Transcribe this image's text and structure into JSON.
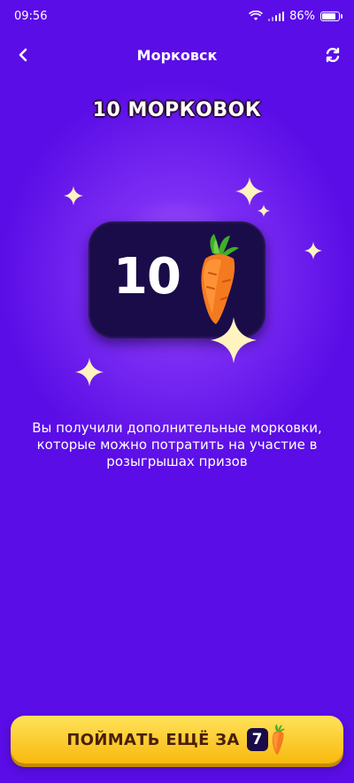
{
  "status": {
    "time": "09:56",
    "battery": "86%",
    "battery_level": 0.86
  },
  "header": {
    "title": "Морковск",
    "back_icon": "back-chevron-icon",
    "refresh_icon": "refresh-icon"
  },
  "reward": {
    "headline": "10 МОРКОВОК",
    "amount": "10",
    "icon": "carrot-icon"
  },
  "description": "Вы получили дополнительные морковки, которые можно потратить на участие в розыгрышах призов",
  "cta": {
    "label": "ПОЙМАТЬ ЕЩЁ ЗА",
    "count": "7",
    "icon": "carrot-icon"
  },
  "colors": {
    "background": "#5a0de6",
    "card": "#1a0c48",
    "button": "#f8c514",
    "button_text": "#4a1f0a"
  }
}
